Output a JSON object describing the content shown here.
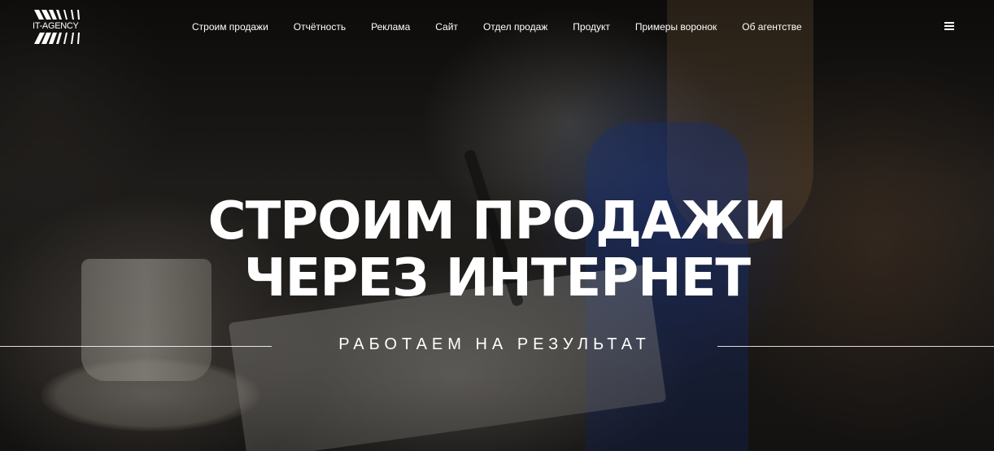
{
  "logo": {
    "text": "IT-AGENCY",
    "icon": "logo-stripes"
  },
  "nav": {
    "items": [
      {
        "label": "Строим продажи"
      },
      {
        "label": "Отчётность"
      },
      {
        "label": "Реклама"
      },
      {
        "label": "Сайт"
      },
      {
        "label": "Отдел продаж"
      },
      {
        "label": "Продукт"
      },
      {
        "label": "Примеры воронок"
      },
      {
        "label": "Об агентстве"
      }
    ],
    "menu_icon": "hamburger-menu-icon"
  },
  "hero": {
    "title_line1": "СТРОИМ ПРОДАЖИ",
    "title_line2": "ЧЕРЕЗ ИНТЕРНЕТ",
    "subtitle": "РАБОТАЕМ НА РЕЗУЛЬТАТ"
  },
  "colors": {
    "text": "#ffffff",
    "background": "#1f1c1a"
  }
}
